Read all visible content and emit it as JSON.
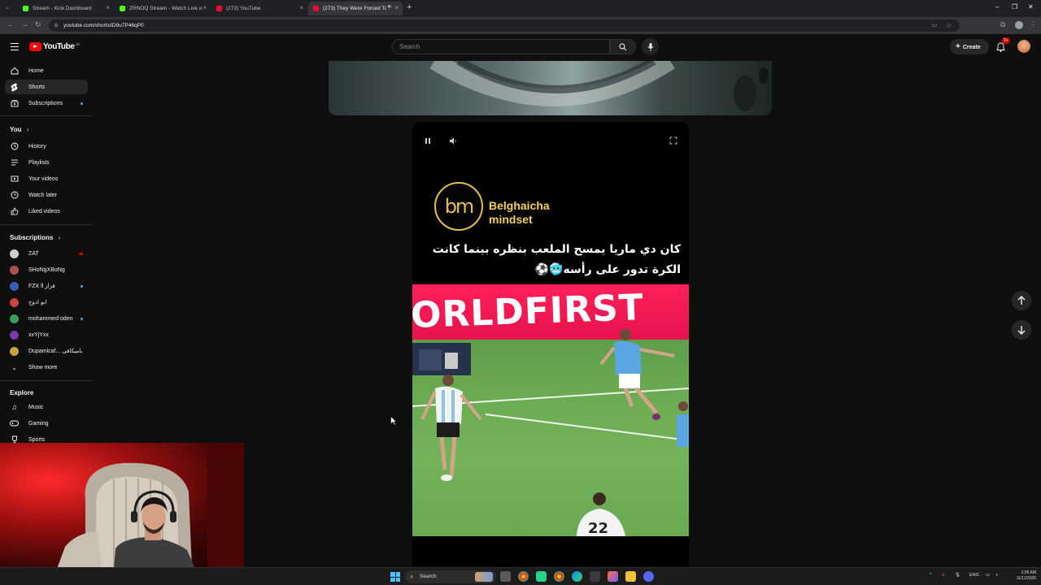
{
  "browser": {
    "tabs": [
      {
        "title": "Stream - Kick Dashboard",
        "favicon_color": "#53fc18"
      },
      {
        "title": "ZRNOQ Stream - Watch Live o...",
        "favicon_color": "#53fc18"
      },
      {
        "title": "(273) YouTube",
        "favicon_color": "#ff0033"
      },
      {
        "title": "(273) They Were Forced To",
        "favicon_color": "#ff0033"
      }
    ],
    "url": "youtube.com/shorts/iD9u7P46qP0"
  },
  "header": {
    "logo_text": "YouTube",
    "logo_superscript": "JO",
    "search_placeholder": "Search",
    "create_label": "Create",
    "notification_badge": "9+"
  },
  "sidebar": {
    "main": [
      {
        "label": "Home",
        "icon": "home-icon"
      },
      {
        "label": "Shorts",
        "icon": "shorts-icon"
      },
      {
        "label": "Subscriptions",
        "icon": "subscriptions-icon"
      }
    ],
    "you_heading": "You",
    "you": [
      {
        "label": "History",
        "icon": "history-icon"
      },
      {
        "label": "Playlists",
        "icon": "playlists-icon"
      },
      {
        "label": "Your videos",
        "icon": "your-videos-icon"
      },
      {
        "label": "Watch later",
        "icon": "watch-later-icon"
      },
      {
        "label": "Liked videos",
        "icon": "liked-icon"
      }
    ],
    "subscriptions_heading": "Subscriptions",
    "subscriptions": [
      {
        "label": "ZAT",
        "color": "#cfcfcf"
      },
      {
        "label": "SHoNgXBoNg",
        "color": "#b05050"
      },
      {
        "label": "FZX ll فزاز",
        "color": "#3b5bb8"
      },
      {
        "label": "ابو ادوج",
        "color": "#c8463a"
      },
      {
        "label": "mohammed oden",
        "color": "#3aa05a"
      },
      {
        "label": "xxYjYxx",
        "color": "#7a3aa8"
      },
      {
        "label": "Dupamicaf... دوبامیکافی",
        "color": "#c7a13a"
      }
    ],
    "show_more": "Show more",
    "explore_heading": "Explore",
    "explore": [
      {
        "label": "Music",
        "icon": "music-icon"
      },
      {
        "label": "Gaming",
        "icon": "gaming-icon"
      },
      {
        "label": "Sports",
        "icon": "sports-icon"
      }
    ]
  },
  "short": {
    "brand_logo": "bm",
    "brand_line1": "Belghaicha",
    "brand_line2": "mindset",
    "caption_line1": "كان دي ماريا يمسح الملعب بنظره بينما كانت",
    "caption_line2": "الكرة تدور على رأسه🥶⚽",
    "banner_text": "ORLDFIRST",
    "jersey_number": "22"
  },
  "taskbar": {
    "search_label": "Search",
    "language": "ENG",
    "time": "1:06 AM",
    "date": "11/11/2025"
  }
}
